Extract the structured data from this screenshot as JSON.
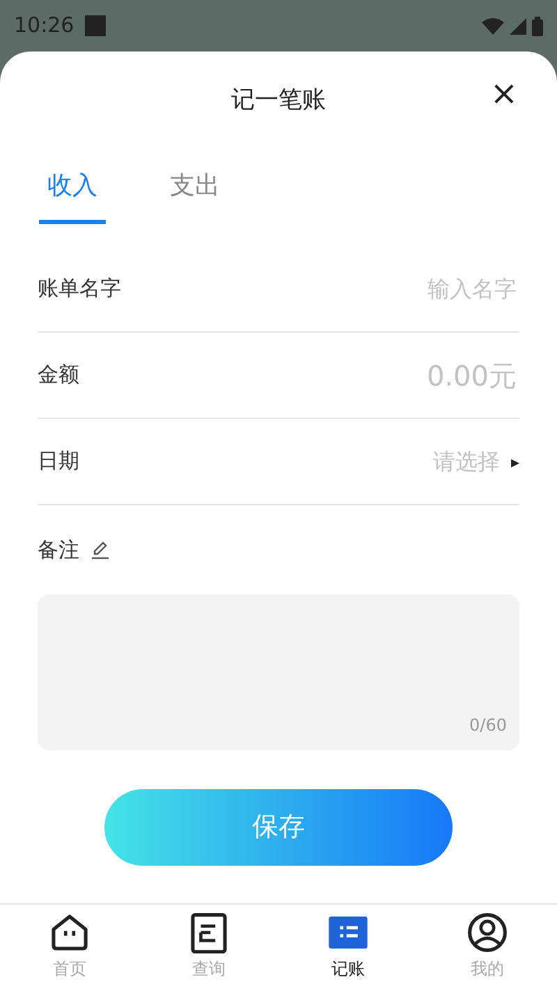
{
  "status_bar": {
    "time": "10:26"
  },
  "sheet": {
    "title": "记一笔账",
    "close": "×"
  },
  "tabs": [
    {
      "label": "收入",
      "selected": true
    },
    {
      "label": "支出",
      "selected": false
    }
  ],
  "fields": [
    {
      "kind": "text",
      "label": "账单名字",
      "placeholder": "输入名字"
    },
    {
      "kind": "amount",
      "label": "金额",
      "placeholder": "0.00元"
    },
    {
      "kind": "select",
      "label": "日期",
      "placeholder": "请选择",
      "arrow": "▸"
    }
  ],
  "note": {
    "label": "备注",
    "counter": "0/60"
  },
  "save_button": "保存",
  "bottom_nav": [
    {
      "label": "首页",
      "kind": "home",
      "selected": false
    },
    {
      "label": "查询",
      "kind": "query",
      "selected": false
    },
    {
      "label": "记账",
      "kind": "record",
      "selected": true
    },
    {
      "label": "我的",
      "kind": "user",
      "selected": false
    }
  ]
}
